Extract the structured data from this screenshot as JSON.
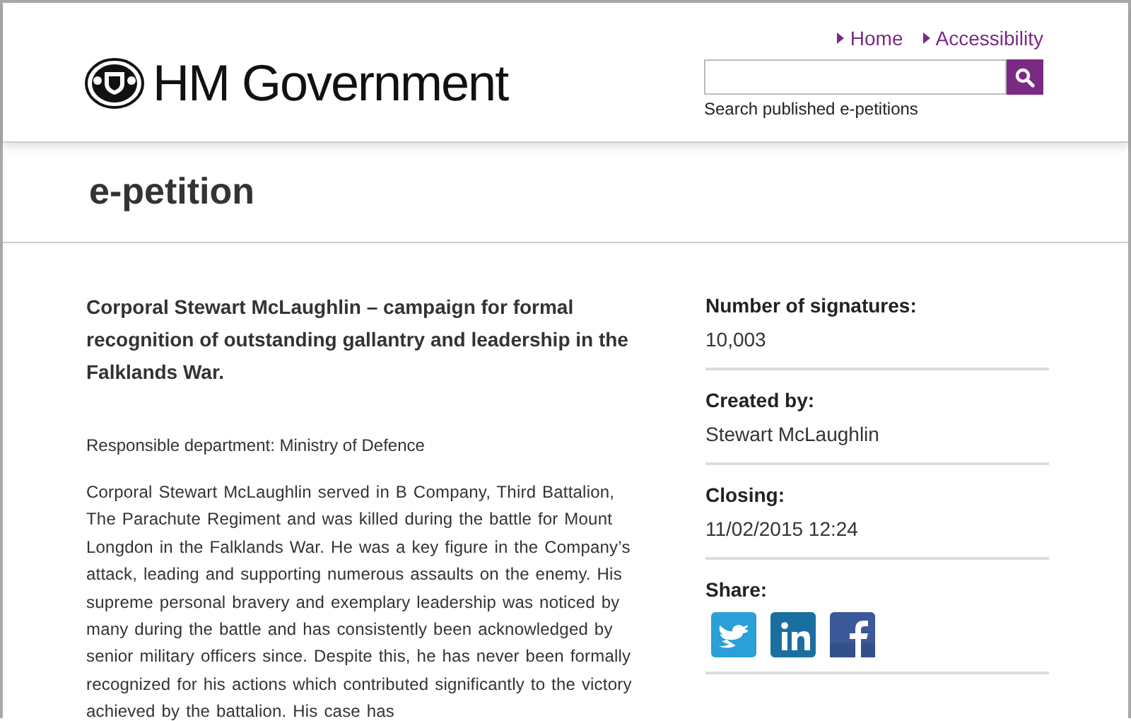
{
  "header": {
    "logo_text": "HM Government",
    "nav_links": [
      "Home",
      "Accessibility"
    ],
    "search": {
      "caption": "Search published e-petitions"
    }
  },
  "page_title": "e-petition",
  "petition": {
    "title": "Corporal Stewart McLaughlin – campaign for formal recognition of outstanding gallantry and leadership in the Falklands War.",
    "department": "Responsible department: Ministry of Defence",
    "body": "Corporal Stewart McLaughlin served in B Company, Third Battalion, The Parachute Regiment and was killed during the battle for Mount Longdon in the Falklands War. He was a key figure in the Company’s attack, leading and supporting numerous assaults on the enemy. His supreme personal bravery and exemplary leadership was noticed by many during the battle and has consistently been acknowledged by senior military officers since. Despite this, he has never been formally recognized for his actions which contributed significantly to the victory achieved by the battalion. His case has"
  },
  "sidebar": {
    "facts": [
      {
        "label": "Number of signatures:",
        "value": "10,003"
      },
      {
        "label": "Created by:",
        "value": "Stewart McLaughlin"
      },
      {
        "label": "Closing:",
        "value": "11/02/2015 12:24"
      }
    ],
    "share": {
      "label": "Share:",
      "services": [
        {
          "kind": "twitter"
        },
        {
          "kind": "linkedin"
        },
        {
          "kind": "facebook"
        }
      ]
    }
  }
}
